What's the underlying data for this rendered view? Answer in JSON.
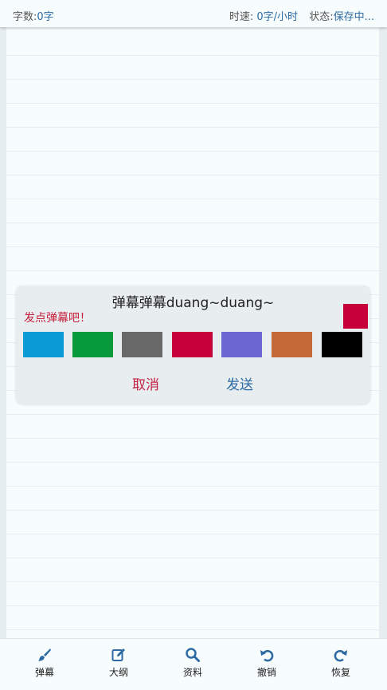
{
  "status": {
    "word_count_label": "字数:",
    "word_count_value": "0字",
    "speed_label": "时速:",
    "speed_value": "0字/小时",
    "state_label": "状态:",
    "state_value": "保存中..."
  },
  "dialog": {
    "title": "弹幕弹幕duang~duang~",
    "hint": "发点弹幕吧！",
    "selected_color": "#c8003a",
    "colors": [
      "#0b9bd6",
      "#079a3c",
      "#686868",
      "#c8003a",
      "#6c66d2",
      "#c36a36",
      "#000000"
    ],
    "cancel_label": "取消",
    "send_label": "发送"
  },
  "tabs": [
    {
      "label": "弹幕",
      "icon": "brush-icon"
    },
    {
      "label": "大纲",
      "icon": "edit-icon"
    },
    {
      "label": "资料",
      "icon": "search-icon"
    },
    {
      "label": "撤销",
      "icon": "undo-icon"
    },
    {
      "label": "恢复",
      "icon": "redo-icon"
    }
  ],
  "accent": "#2d6aa3"
}
